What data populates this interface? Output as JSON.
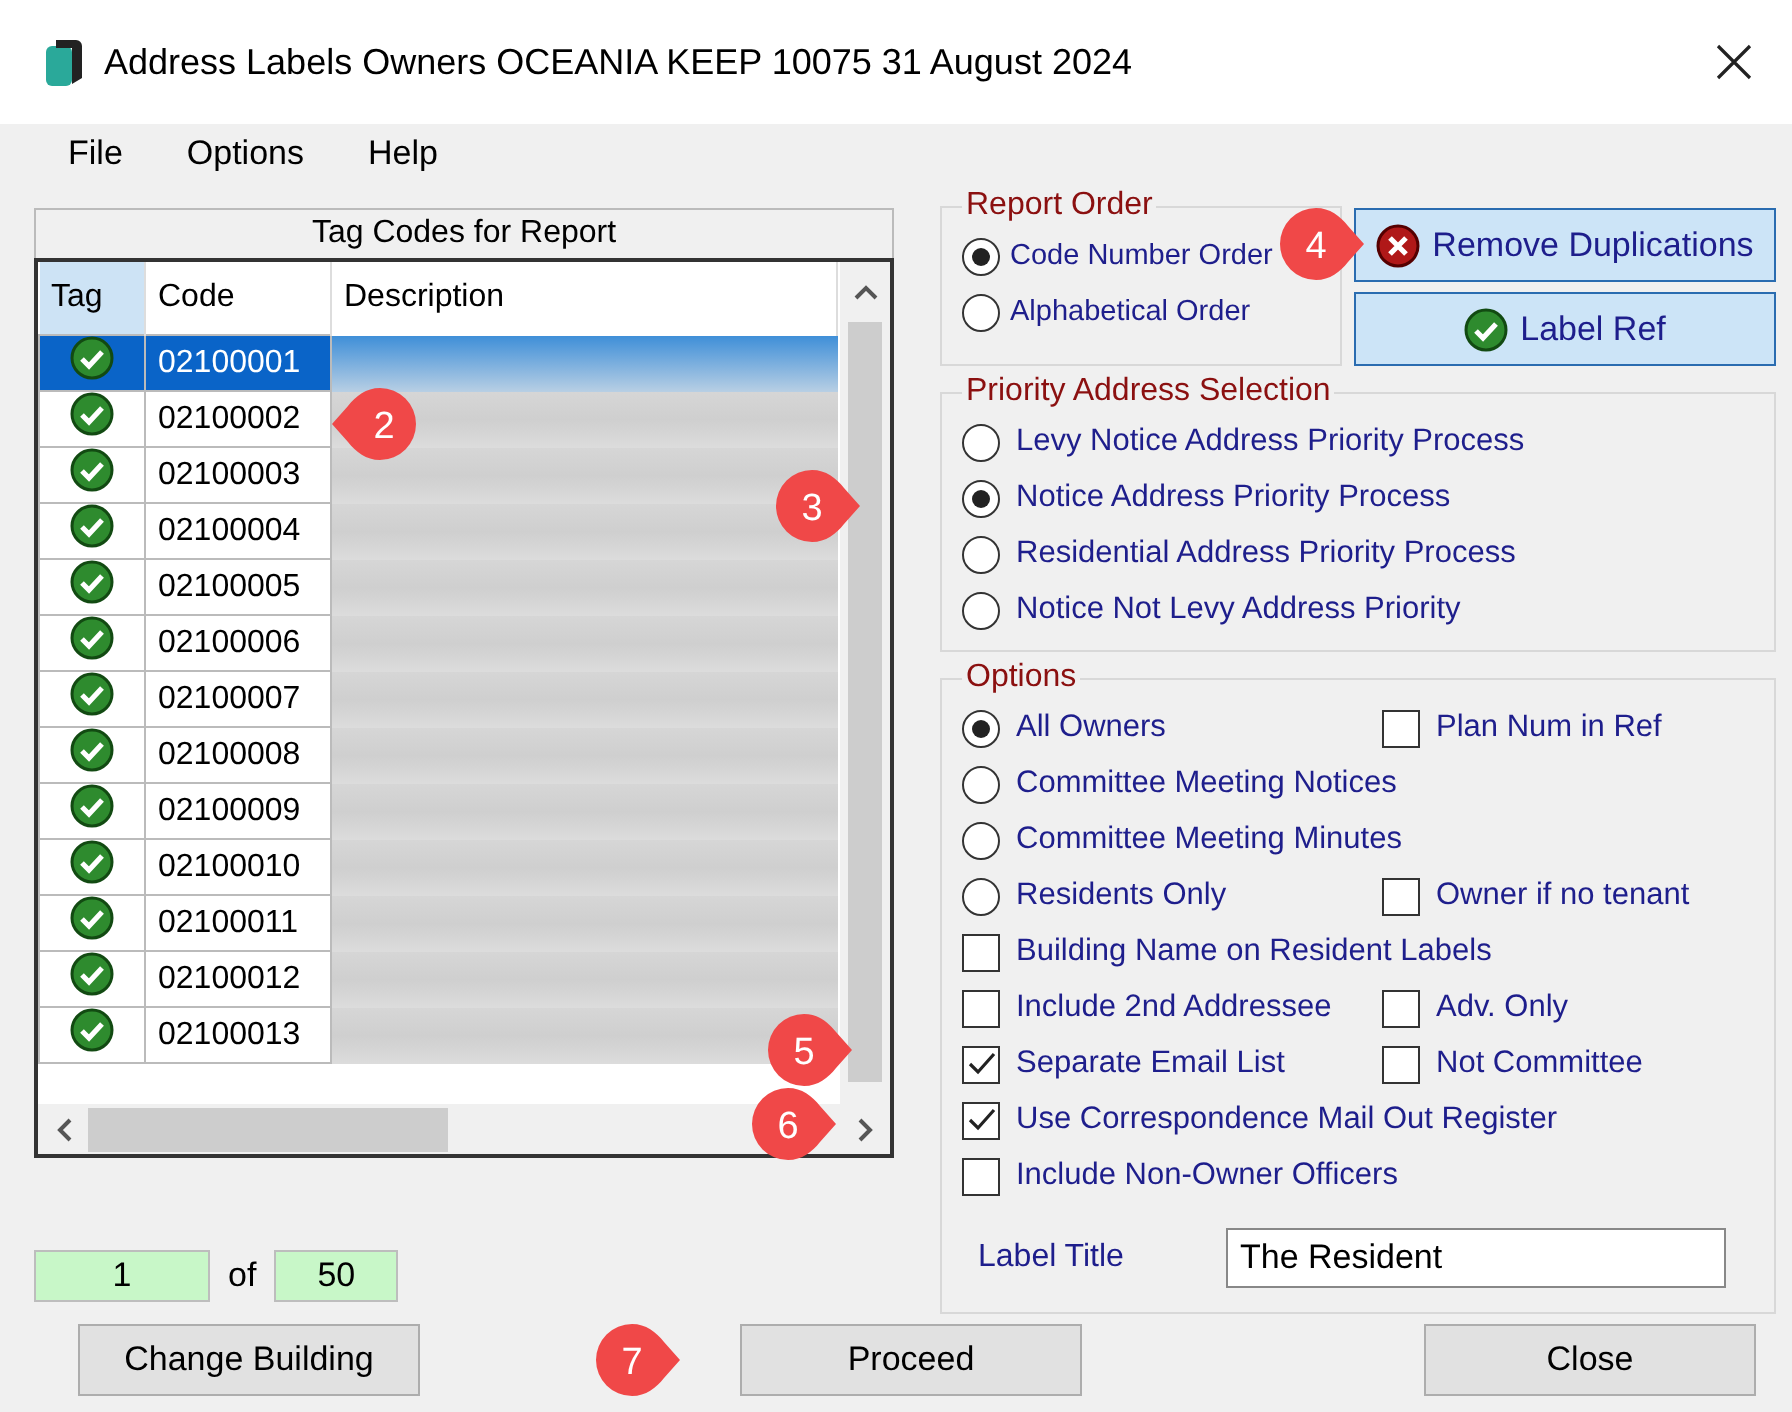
{
  "window": {
    "title": "Address Labels Owners OCEANIA KEEP 10075 31 August 2024"
  },
  "menu": [
    "File",
    "Options",
    "Help"
  ],
  "tag_panel": {
    "title": "Tag Codes for Report",
    "columns": [
      "Tag",
      "Code",
      "Description"
    ],
    "rows": [
      {
        "code": "02100001",
        "tagged": true,
        "selected": true
      },
      {
        "code": "02100002",
        "tagged": true,
        "selected": false
      },
      {
        "code": "02100003",
        "tagged": true,
        "selected": false
      },
      {
        "code": "02100004",
        "tagged": true,
        "selected": false
      },
      {
        "code": "02100005",
        "tagged": true,
        "selected": false
      },
      {
        "code": "02100006",
        "tagged": true,
        "selected": false
      },
      {
        "code": "02100007",
        "tagged": true,
        "selected": false
      },
      {
        "code": "02100008",
        "tagged": true,
        "selected": false
      },
      {
        "code": "02100009",
        "tagged": true,
        "selected": false
      },
      {
        "code": "02100010",
        "tagged": true,
        "selected": false
      },
      {
        "code": "02100011",
        "tagged": true,
        "selected": false
      },
      {
        "code": "02100012",
        "tagged": true,
        "selected": false
      },
      {
        "code": "02100013",
        "tagged": true,
        "selected": false
      }
    ]
  },
  "counter": {
    "current": "1",
    "of": "of",
    "total": "50"
  },
  "report_order": {
    "legend": "Report Order",
    "options": [
      {
        "label": "Code Number Order",
        "selected": true
      },
      {
        "label": "Alphabetical Order",
        "selected": false
      }
    ]
  },
  "side_buttons": [
    {
      "label": "Remove Duplications",
      "kind": "remove"
    },
    {
      "label": "Label Ref",
      "kind": "check"
    }
  ],
  "priority": {
    "legend": "Priority Address Selection",
    "options": [
      {
        "label": "Levy Notice Address Priority Process",
        "selected": false
      },
      {
        "label": "Notice Address Priority Process",
        "selected": true
      },
      {
        "label": "Residential Address Priority Process",
        "selected": false
      },
      {
        "label": "Notice Not Levy Address Priority",
        "selected": false
      }
    ]
  },
  "options": {
    "legend": "Options",
    "rows": [
      [
        {
          "kind": "radio",
          "label": "All Owners",
          "selected": true
        },
        {
          "kind": "checkbox",
          "label": "Plan Num in Ref",
          "checked": false
        }
      ],
      [
        {
          "kind": "radio",
          "label": "Committee Meeting Notices",
          "selected": false
        }
      ],
      [
        {
          "kind": "radio",
          "label": "Committee Meeting Minutes",
          "selected": false
        }
      ],
      [
        {
          "kind": "radio",
          "label": "Residents Only",
          "selected": false
        },
        {
          "kind": "checkbox",
          "label": "Owner if no tenant",
          "checked": false
        }
      ],
      [
        {
          "kind": "checkbox",
          "label": "Building Name on Resident Labels",
          "checked": false
        }
      ],
      [
        {
          "kind": "checkbox",
          "label": "Include 2nd Addressee",
          "checked": false
        },
        {
          "kind": "checkbox",
          "label": "Adv. Only",
          "checked": false
        }
      ],
      [
        {
          "kind": "checkbox",
          "label": "Separate Email List",
          "checked": true
        },
        {
          "kind": "checkbox",
          "label": "Not Committee",
          "checked": false
        }
      ],
      [
        {
          "kind": "checkbox",
          "label": "Use Correspondence Mail Out Register",
          "checked": true
        }
      ],
      [
        {
          "kind": "checkbox",
          "label": "Include Non-Owner Officers",
          "checked": false
        }
      ]
    ],
    "label_title": {
      "label": "Label Title",
      "value": "The Resident"
    }
  },
  "buttons": [
    "Change Building",
    "Proceed",
    "Close"
  ],
  "callouts": [
    {
      "number": "2"
    },
    {
      "number": "3"
    },
    {
      "number": "4"
    },
    {
      "number": "5"
    },
    {
      "number": "6"
    },
    {
      "number": "7"
    }
  ]
}
